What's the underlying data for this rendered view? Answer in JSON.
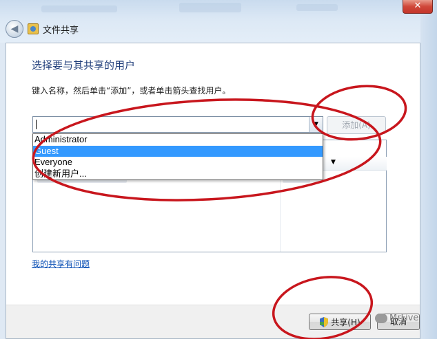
{
  "window": {
    "title": "文件共享",
    "close_symbol": "✕",
    "back_symbol": "◀"
  },
  "dialog": {
    "heading": "选择要与其共享的用户",
    "instruction": "键入名称，然后单击“添加”，或者单击箭头查找用户。",
    "name_input_value": "",
    "add_button_label": "添加(A)",
    "dropdown_options": [
      "Administrator",
      "Guest",
      "Everyone",
      "创建新用户..."
    ],
    "selected_option": "Guest",
    "help_link": "我的共享有问题",
    "share_button_label": "共享(H)",
    "cancel_button_label": "取消"
  },
  "watermark": {
    "text": "MrFive"
  },
  "icons": {
    "back": "back-arrow-icon",
    "share": "share-folder-icon",
    "shield": "uac-shield-icon",
    "combo": "chevron-down-icon"
  },
  "colors": {
    "annotation_red": "#c8161d",
    "selection_blue": "#3399ff",
    "link_blue": "#0a4fb5",
    "heading_blue": "#1f3d7a"
  }
}
